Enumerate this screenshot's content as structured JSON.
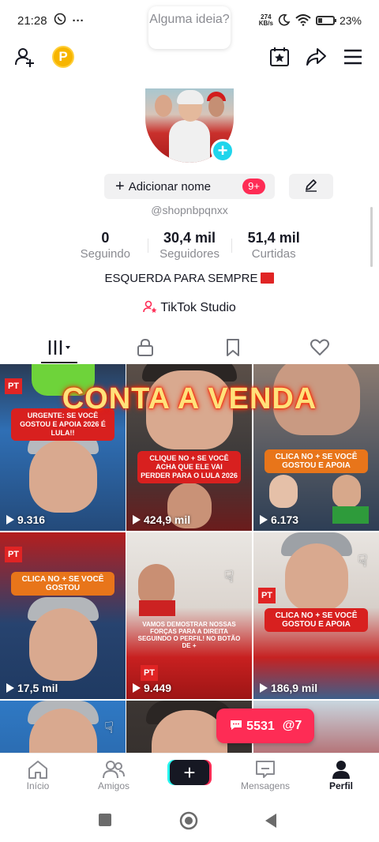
{
  "status_bar": {
    "time": "21:28",
    "left_icons": [
      "whatsapp-icon",
      "more-icon"
    ],
    "more": "···",
    "kbs_value": "274",
    "kbs_unit": "KB/s",
    "battery": "23%",
    "battery_level": 0.23
  },
  "header": {
    "coin_label": "P",
    "idea_bubble": "Alguma ideia?",
    "icons": [
      "add-friend-icon",
      "coin-icon",
      "calendar-star-icon",
      "share-icon",
      "menu-icon"
    ]
  },
  "profile": {
    "add_name_label": "Adicionar nome",
    "add_name_badge": "9+",
    "handle": "@shopnbpqnxx",
    "bio": "ESQUERDA PARA SEMPRE",
    "studio_label": "TikTok Studio"
  },
  "stats": [
    {
      "value": "0",
      "label": "Seguindo"
    },
    {
      "value": "30,4 mil",
      "label": "Seguidores"
    },
    {
      "value": "51,4 mil",
      "label": "Curtidas"
    }
  ],
  "tabs": [
    "videos-grid-icon",
    "lock-icon",
    "bookmark-icon",
    "heart-icon"
  ],
  "grid": {
    "banner": "CONTA A VENDA",
    "videos": [
      {
        "views": "9.316",
        "caption": "URGENTE: SE VOCÊ GOSTOU E APOIA 2026 É LULA!!",
        "caption_color": "#d8201f"
      },
      {
        "views": "424,9 mil",
        "caption": "CLIQUE NO + SE VOCÊ ACHA QUE ELE VAI PERDER PARA O LULA 2026",
        "caption_color": "#d8201f"
      },
      {
        "views": "6.173",
        "caption": "CLICA NO + SE VOCÊ GOSTOU E APOIA",
        "caption_color": "#e8751a"
      },
      {
        "views": "17,5 mil",
        "caption": "CLICA NO + SE VOCÊ GOSTOU",
        "caption_color": "#e8751a"
      },
      {
        "views": "9.449",
        "caption": "VAMOS DEMOSTRAR NOSSAS FORÇAS PARA A DIREITA SEGUINDO O PERFIL! NO BOTÃO DE +",
        "caption_color": "#d8201f"
      },
      {
        "views": "186,9 mil",
        "caption": "CLICA NO + SE VOCÊ GOSTOU E APOIA",
        "caption_color": "#d8201f"
      }
    ],
    "pt_label": "PT"
  },
  "comments_pill": {
    "comments": "5531",
    "mentions": "7",
    "mention_prefix": "@"
  },
  "bottom_nav": [
    {
      "label": "Início",
      "icon": "home-icon"
    },
    {
      "label": "Amigos",
      "icon": "friends-icon"
    },
    {
      "label": "+",
      "icon": "create-icon"
    },
    {
      "label": "Mensagens",
      "icon": "inbox-icon"
    },
    {
      "label": "Perfil",
      "icon": "profile-icon"
    }
  ],
  "colors": {
    "accent": "#fe2c55",
    "cyan": "#20d5ec",
    "text": "#161823",
    "muted": "#8a8b91"
  }
}
